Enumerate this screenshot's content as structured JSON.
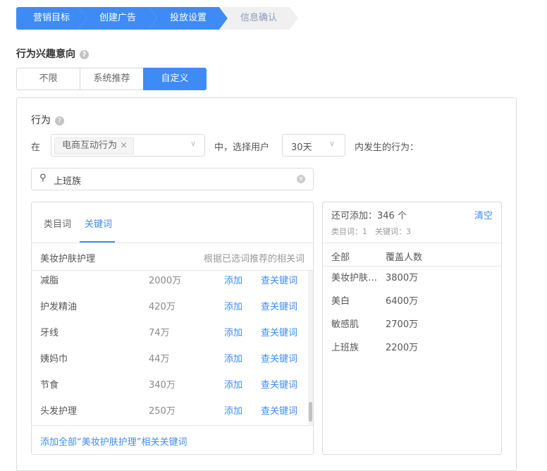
{
  "steps": [
    "营销目标",
    "创建广告",
    "投放设置",
    "信息确认"
  ],
  "section_title": "行为兴趣意向",
  "segments": [
    "不限",
    "系统推荐",
    "自定义"
  ],
  "behavior": {
    "title": "行为",
    "prefix": "在",
    "tag": "电商互动行为",
    "middle": "中，选择用户",
    "period": "30天",
    "suffix": "内发生的行为："
  },
  "search": {
    "value": "上班族"
  },
  "left": {
    "tabs": [
      "类目词",
      "关键词"
    ],
    "category": "美妆护肤护理",
    "hint": "根据已选词推荐的相关词",
    "add_label": "添加",
    "lookup_label": "查关键词",
    "rows": [
      {
        "name": "减脂",
        "count": "2000万"
      },
      {
        "name": "护发精油",
        "count": "420万"
      },
      {
        "name": "牙线",
        "count": "74万"
      },
      {
        "name": "姨妈巾",
        "count": "44万"
      },
      {
        "name": "节食",
        "count": "340万"
      },
      {
        "name": "头发护理",
        "count": "250万"
      }
    ],
    "footer": "添加全部“美妆护肤护理”相关关键词"
  },
  "right": {
    "remaining": "还可添加：346 个",
    "clear": "清空",
    "counts": "类目词：1　关键词：3",
    "headers": [
      "全部",
      "覆盖人数"
    ],
    "rows": [
      {
        "name": "美妆护肤…",
        "count": "3800万"
      },
      {
        "name": "美白",
        "count": "6400万"
      },
      {
        "name": "敏感肌",
        "count": "2700万"
      },
      {
        "name": "上班族",
        "count": "2200万"
      }
    ]
  }
}
